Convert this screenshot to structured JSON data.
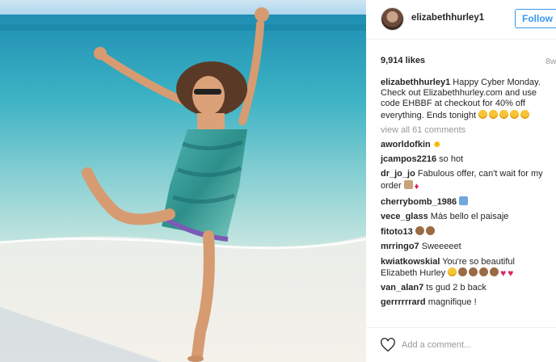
{
  "post": {
    "username": "elizabethhurley1",
    "follow_label": "Follow",
    "likes": "9,914 likes",
    "age": "8w",
    "view_all": "view all 61 comments",
    "add_comment_placeholder": "Add a comment..."
  },
  "comments": [
    {
      "user": "elizabethhurley1",
      "text": "Happy Cyber Monday. Check out Elizabethhurley.com and use code EHBBF at checkout for 40% off everything. Ends tonight",
      "emoji": [
        "yellow",
        "yellow",
        "yellow",
        "yellow",
        "yellow"
      ]
    },
    {
      "user": "aworldofkin",
      "text": "",
      "emoji": [
        "burst"
      ]
    },
    {
      "user": "jcampos2216",
      "text": "so hot",
      "emoji": []
    },
    {
      "user": "dr_jo_jo",
      "text": "Fabulous offer, can't wait for my order",
      "emoji": [
        "box",
        "red"
      ]
    },
    {
      "user": "cherrybomb_1986",
      "text": "",
      "emoji": [
        "blue"
      ]
    },
    {
      "user": "vece_glass",
      "text": "Más bello el paisaje",
      "emoji": []
    },
    {
      "user": "fitoto13",
      "text": "",
      "emoji": [
        "brown",
        "brown"
      ]
    },
    {
      "user": "mrringo7",
      "text": "Sweeeeet",
      "emoji": []
    },
    {
      "user": "kwiatkowskial",
      "text": "You're so beautiful Elizabeth Hurley",
      "emoji": [
        "yellow",
        "brown",
        "brown",
        "brown",
        "brown",
        "heart",
        "heart"
      ]
    },
    {
      "user": "van_alan7",
      "text": "ts gud 2 b back",
      "emoji": []
    },
    {
      "user": "gerrrrrrard",
      "text": "magnifique !",
      "emoji": []
    }
  ],
  "icons": {
    "like": "heart-outline-icon",
    "avatar": "profile-avatar"
  },
  "colors": {
    "accent": "#3897f0",
    "muted": "#999999",
    "text": "#262626"
  }
}
